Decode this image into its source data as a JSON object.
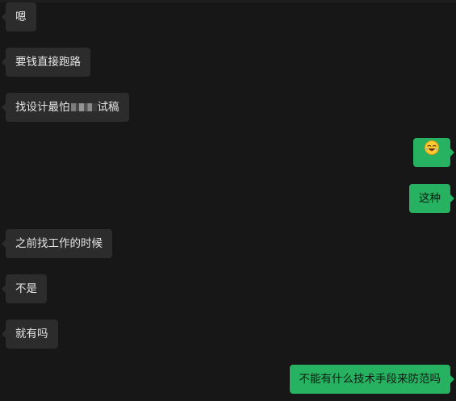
{
  "messages": [
    {
      "side": "in",
      "text": "嗯"
    },
    {
      "side": "in",
      "text": "要钱直接跑路"
    },
    {
      "side": "in",
      "text_before": "找设计最怕",
      "text_after": "试稿"
    },
    {
      "side": "out",
      "emoji": "laughing-face-emoji"
    },
    {
      "side": "out",
      "text": "这种"
    },
    {
      "side": "in",
      "text": "之前找工作的时候"
    },
    {
      "side": "in",
      "text": "不是"
    },
    {
      "side": "in",
      "text": "就有吗"
    },
    {
      "side": "out",
      "text": "不能有什么技术手段来防范吗"
    }
  ],
  "colors": {
    "background": "#171717",
    "incoming_bubble": "#2c2c2c",
    "outgoing_bubble": "#26b260"
  }
}
